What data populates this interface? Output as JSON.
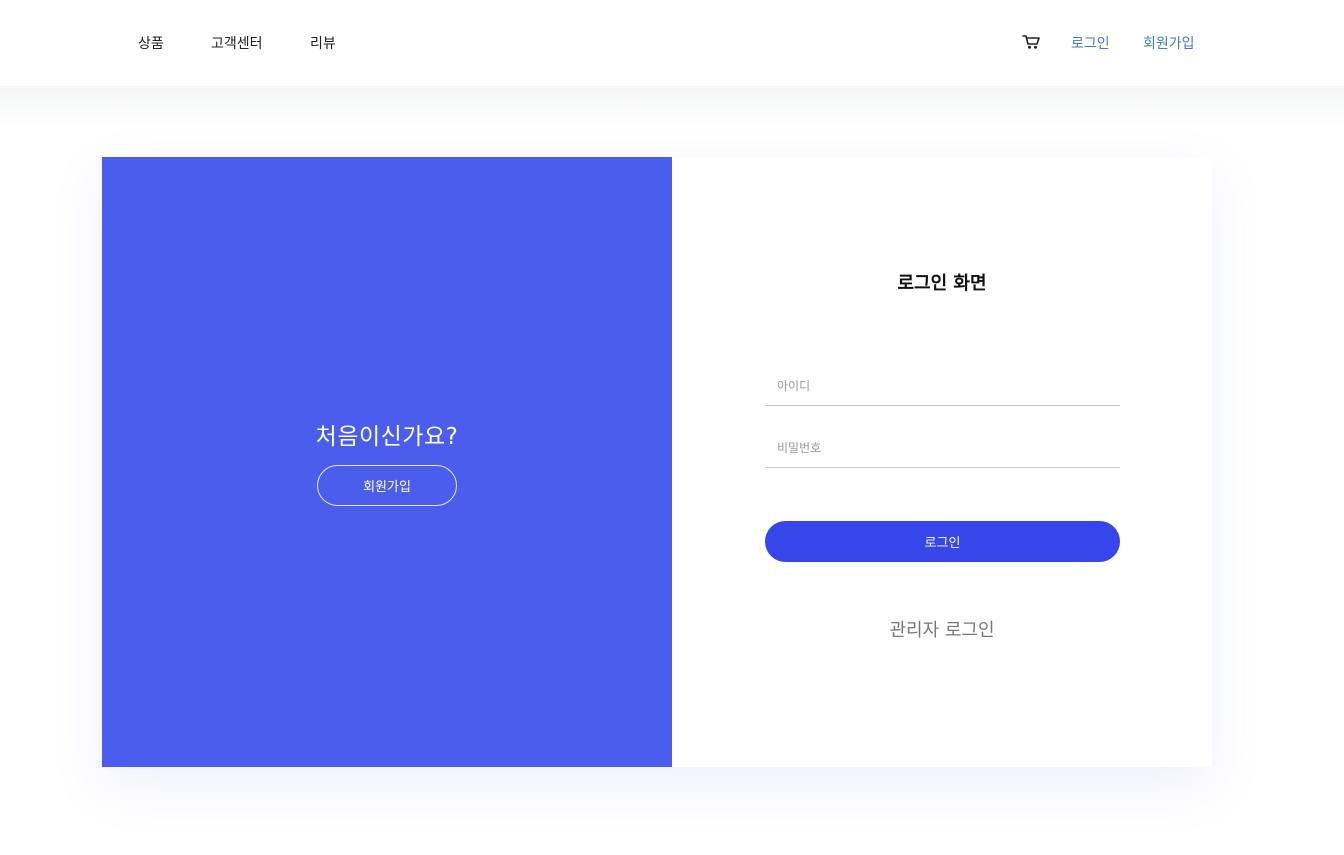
{
  "nav": {
    "left_items": [
      "상품",
      "고객센터",
      "리뷰"
    ],
    "cart_icon": "cart-icon",
    "login_link": "로그인",
    "signup_link": "회원가입",
    "link_color": "#3d7ad6"
  },
  "left_panel": {
    "title": "처음이신가요?",
    "signup_button": "회원가입",
    "background_color": "#4a5ded"
  },
  "login_form": {
    "title": "로그인 화면",
    "id_placeholder": "아이디",
    "password_placeholder": "비밀번호",
    "submit_label": "로그인",
    "submit_color": "#3646ea",
    "admin_login": "관리자 로그인"
  }
}
